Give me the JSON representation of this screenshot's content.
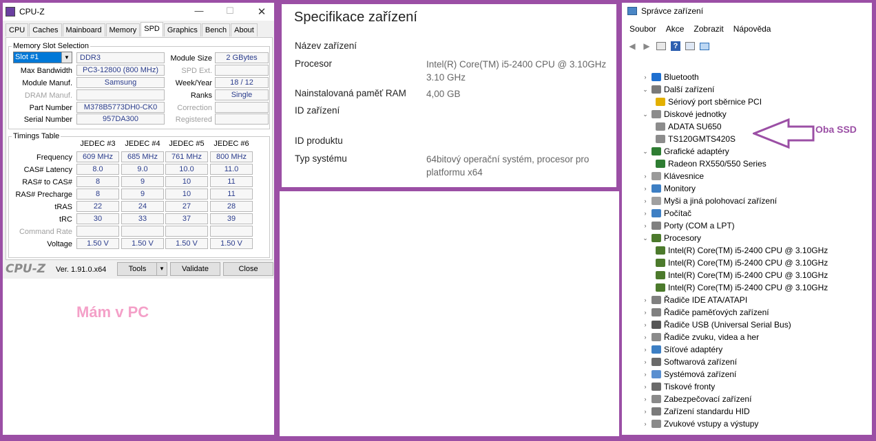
{
  "cpuz": {
    "title": "CPU-Z",
    "tabs": [
      "CPU",
      "Caches",
      "Mainboard",
      "Memory",
      "SPD",
      "Graphics",
      "Bench",
      "About"
    ],
    "active_tab": "SPD",
    "slot_group": "Memory Slot Selection",
    "slot_value": "Slot #1",
    "mem_type": "DDR3",
    "module_size_label": "Module Size",
    "module_size": "2 GBytes",
    "max_bw_label": "Max Bandwidth",
    "max_bw": "PC3-12800 (800 MHz)",
    "spd_ext_label": "SPD Ext.",
    "spd_ext": "",
    "manuf_label": "Module Manuf.",
    "manuf": "Samsung",
    "week_label": "Week/Year",
    "week": "18 / 12",
    "dram_label": "DRAM Manuf.",
    "dram": "",
    "ranks_label": "Ranks",
    "ranks": "Single",
    "part_label": "Part Number",
    "part": "M378B5773DH0-CK0",
    "corr_label": "Correction",
    "corr": "",
    "serial_label": "Serial Number",
    "serial": "957DA300",
    "reg_label": "Registered",
    "reg": "",
    "timings_group": "Timings Table",
    "timing_cols": [
      "JEDEC #3",
      "JEDEC #4",
      "JEDEC #5",
      "JEDEC #6"
    ],
    "timing_rows": [
      {
        "label": "Frequency",
        "values": [
          "609 MHz",
          "685 MHz",
          "761 MHz",
          "800 MHz"
        ]
      },
      {
        "label": "CAS# Latency",
        "values": [
          "8.0",
          "9.0",
          "10.0",
          "11.0"
        ]
      },
      {
        "label": "RAS# to CAS#",
        "values": [
          "8",
          "9",
          "10",
          "11"
        ]
      },
      {
        "label": "RAS# Precharge",
        "values": [
          "8",
          "9",
          "10",
          "11"
        ]
      },
      {
        "label": "tRAS",
        "values": [
          "22",
          "24",
          "27",
          "28"
        ]
      },
      {
        "label": "tRC",
        "values": [
          "30",
          "33",
          "37",
          "39"
        ]
      },
      {
        "label": "Command Rate",
        "values": [
          "",
          "",
          "",
          ""
        ]
      },
      {
        "label": "Voltage",
        "values": [
          "1.50 V",
          "1.50 V",
          "1.50 V",
          "1.50 V"
        ]
      }
    ],
    "logo": "CPU-Z",
    "version": "Ver. 1.91.0.x64",
    "tools_btn": "Tools",
    "validate_btn": "Validate",
    "close_btn": "Close",
    "annotation": "Mám v PC",
    "annotation_color": "#f4a0c8"
  },
  "specs": {
    "title": "Specifikace zařízení",
    "rows": [
      {
        "label": "Název zařízení",
        "value": ""
      },
      {
        "label": "Procesor",
        "value": "Intel(R) Core(TM) i5-2400 CPU @ 3.10GHz 3.10 GHz"
      },
      {
        "label": "Nainstalovaná paměť RAM",
        "value": "4,00 GB"
      },
      {
        "label": "ID zařízení",
        "value": ""
      },
      {
        "label": "ID produktu",
        "value": ""
      },
      {
        "label": "Typ systému",
        "value": "64bitový operační systém, procesor pro platformu x64"
      }
    ]
  },
  "devmgr": {
    "title": "Správce zařízení",
    "menu": [
      "Soubor",
      "Akce",
      "Zobrazit",
      "Nápověda"
    ],
    "tree": [
      {
        "label": "Bluetooth",
        "level": 0,
        "exp": "›",
        "icon": "bluetooth-icon"
      },
      {
        "label": "Další zařízení",
        "level": 0,
        "exp": "⌄",
        "icon": "other-devices-icon"
      },
      {
        "label": "Sériový port sběrnice PCI",
        "level": 1,
        "exp": "",
        "icon": "warning-device-icon"
      },
      {
        "label": "Diskové jednotky",
        "level": 0,
        "exp": "⌄",
        "icon": "disk-drives-icon"
      },
      {
        "label": "ADATA SU650",
        "level": 1,
        "exp": "",
        "icon": "disk-icon"
      },
      {
        "label": "TS120GMTS420S",
        "level": 1,
        "exp": "",
        "icon": "disk-icon"
      },
      {
        "label": "Grafické adaptéry",
        "level": 0,
        "exp": "⌄",
        "icon": "display-adapter-icon"
      },
      {
        "label": "Radeon RX550/550 Series",
        "level": 1,
        "exp": "",
        "icon": "display-adapter-icon"
      },
      {
        "label": "Klávesnice",
        "level": 0,
        "exp": "›",
        "icon": "keyboard-icon"
      },
      {
        "label": "Monitory",
        "level": 0,
        "exp": "›",
        "icon": "monitor-icon"
      },
      {
        "label": "Myši a jiná polohovací zařízení",
        "level": 0,
        "exp": "›",
        "icon": "mouse-icon"
      },
      {
        "label": "Počítač",
        "level": 0,
        "exp": "›",
        "icon": "computer-icon"
      },
      {
        "label": "Porty (COM a LPT)",
        "level": 0,
        "exp": "›",
        "icon": "port-icon"
      },
      {
        "label": "Procesory",
        "level": 0,
        "exp": "⌄",
        "icon": "processor-icon"
      },
      {
        "label": "Intel(R) Core(TM) i5-2400 CPU @ 3.10GHz",
        "level": 1,
        "exp": "",
        "icon": "processor-icon"
      },
      {
        "label": "Intel(R) Core(TM) i5-2400 CPU @ 3.10GHz",
        "level": 1,
        "exp": "",
        "icon": "processor-icon"
      },
      {
        "label": "Intel(R) Core(TM) i5-2400 CPU @ 3.10GHz",
        "level": 1,
        "exp": "",
        "icon": "processor-icon"
      },
      {
        "label": "Intel(R) Core(TM) i5-2400 CPU @ 3.10GHz",
        "level": 1,
        "exp": "",
        "icon": "processor-icon"
      },
      {
        "label": "Řadiče IDE ATA/ATAPI",
        "level": 0,
        "exp": "›",
        "icon": "ide-controller-icon"
      },
      {
        "label": "Řadiče paměťových zařízení",
        "level": 0,
        "exp": "›",
        "icon": "storage-controller-icon"
      },
      {
        "label": "Řadiče USB (Universal Serial Bus)",
        "level": 0,
        "exp": "›",
        "icon": "usb-icon"
      },
      {
        "label": "Řadiče zvuku, videa a her",
        "level": 0,
        "exp": "›",
        "icon": "sound-icon"
      },
      {
        "label": "Síťové adaptéry",
        "level": 0,
        "exp": "›",
        "icon": "network-adapter-icon"
      },
      {
        "label": "Softwarová zařízení",
        "level": 0,
        "exp": "›",
        "icon": "software-device-icon"
      },
      {
        "label": "Systémová zařízení",
        "level": 0,
        "exp": "›",
        "icon": "system-device-icon"
      },
      {
        "label": "Tiskové fronty",
        "level": 0,
        "exp": "›",
        "icon": "printer-icon"
      },
      {
        "label": "Zabezpečovací zařízení",
        "level": 0,
        "exp": "›",
        "icon": "security-device-icon"
      },
      {
        "label": "Zařízení standardu HID",
        "level": 0,
        "exp": "›",
        "icon": "hid-icon"
      },
      {
        "label": "Zvukové vstupy a výstupy",
        "level": 0,
        "exp": "›",
        "icon": "audio-io-icon"
      }
    ],
    "annotation": "Oba SSD",
    "annotation_color": "#9b4fa5"
  }
}
